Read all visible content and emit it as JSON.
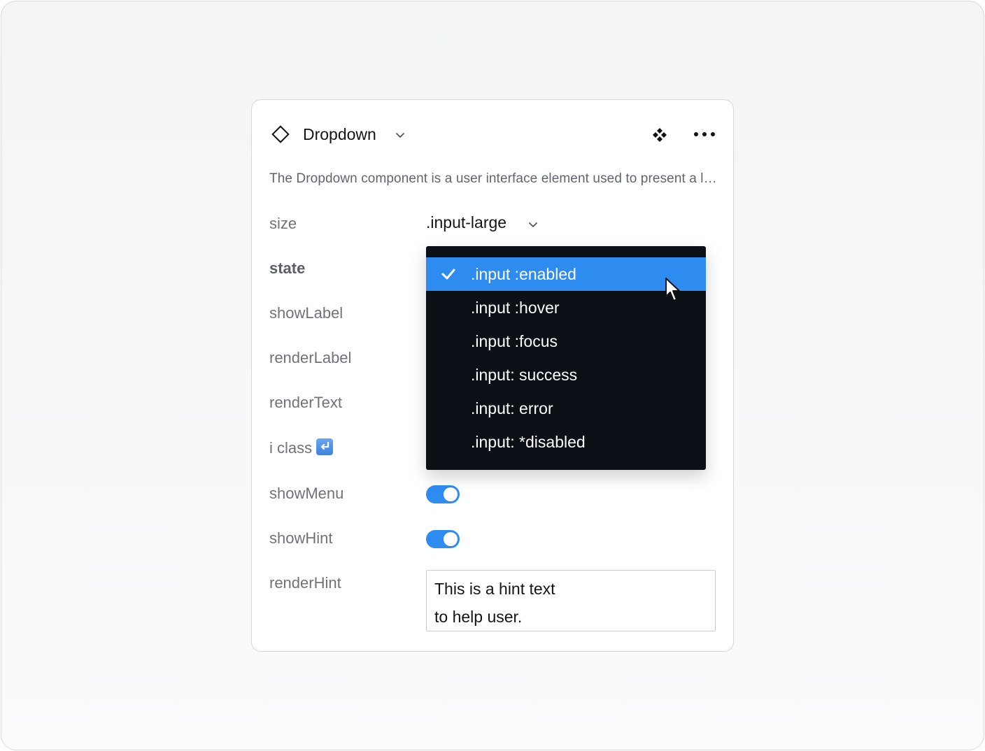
{
  "component": {
    "title": "Dropdown",
    "description": "The Dropdown component is a user interface element used to present a list of options to the user."
  },
  "properties": {
    "size": {
      "label": "size",
      "value": ".input-large"
    },
    "state": {
      "label": "state"
    },
    "showLabel": {
      "label": "showLabel"
    },
    "renderLabel": {
      "label": "renderLabel"
    },
    "renderText": {
      "label": "renderText"
    },
    "iclass": {
      "label": "i class"
    },
    "showMenu": {
      "label": "showMenu",
      "value": true
    },
    "showHint": {
      "label": "showHint",
      "value": true
    },
    "renderHint": {
      "label": "renderHint",
      "value": "This is a hint text\nto help user."
    }
  },
  "state_menu": {
    "selected_index": 0,
    "items": [
      {
        "label": ".input :enabled"
      },
      {
        "label": ".input :hover"
      },
      {
        "label": ".input :focus"
      },
      {
        "label": ".input: success"
      },
      {
        "label": ".input: error"
      },
      {
        "label": ".input: *disabled"
      }
    ]
  },
  "colors": {
    "accent": "#2e8cf0",
    "menu_background": "#0b0f16",
    "label_text": "#6e737b"
  },
  "icons": {
    "component": "diamond-icon",
    "title_chevron": "chevron-down-icon",
    "instance": "component-instance-icon",
    "more": "more-horizontal-icon",
    "check": "check-icon",
    "cursor": "mouse-pointer-icon",
    "iclass": "return-arrow-emoji-icon"
  }
}
